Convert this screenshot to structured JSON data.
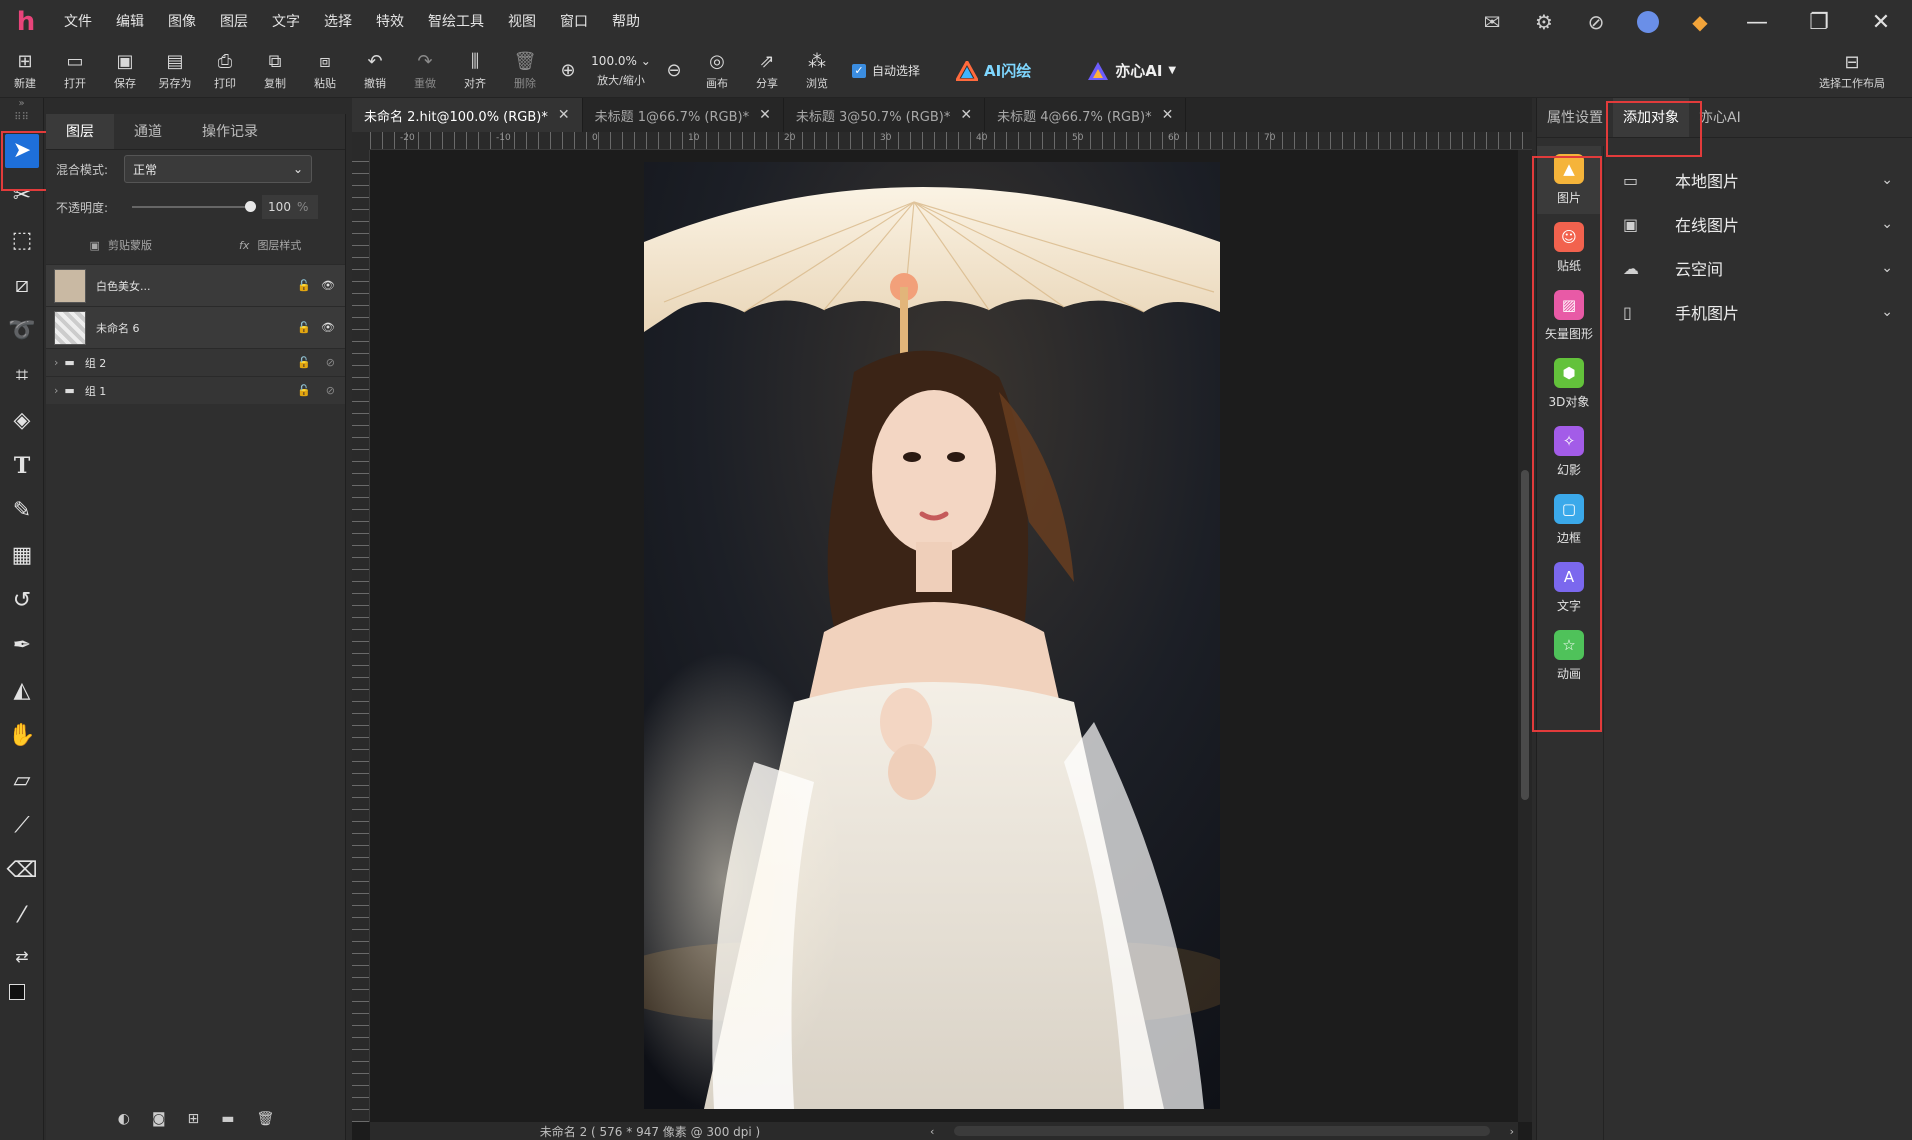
{
  "app": {
    "logo_text": "h",
    "menu": [
      "文件",
      "编辑",
      "图像",
      "图层",
      "文字",
      "选择",
      "特效",
      "智绘工具",
      "视图",
      "窗口",
      "帮助"
    ]
  },
  "toolbar": {
    "new": "新建",
    "open": "打开",
    "save": "保存",
    "save_as": "另存为",
    "print": "打印",
    "copy": "复制",
    "paste": "粘贴",
    "undo": "撤销",
    "redo": "重做",
    "align": "对齐",
    "delete": "删除",
    "zoom_value": "100.0%",
    "zoom_label": "放大/缩小",
    "canvas": "画布",
    "share": "分享",
    "browse": "浏览",
    "auto_select": "自动选择",
    "ai_flash": "AI闪绘",
    "yixin_ai": "亦心AI",
    "workspace": "选择工作布局"
  },
  "layers_panel": {
    "tabs": [
      "图层",
      "通道",
      "操作记录"
    ],
    "blend_label": "混合模式:",
    "blend_value": "正常",
    "opacity_label": "不透明度:",
    "opacity_value": "100",
    "opacity_unit": "%",
    "clip_label": "剪贴蒙版",
    "style_label": "图层样式",
    "layers": [
      {
        "name": "白色美女..."
      },
      {
        "name": "未命名 6"
      }
    ],
    "groups": [
      {
        "name": "组 2"
      },
      {
        "name": "组 1"
      }
    ]
  },
  "doc_tabs": [
    {
      "label": "未命名 2.hit@100.0% (RGB)*",
      "active": true
    },
    {
      "label": "未标题 1@66.7% (RGB)*",
      "active": false
    },
    {
      "label": "未标题 3@50.7% (RGB)*",
      "active": false
    },
    {
      "label": "未标题 4@66.7% (RGB)*",
      "active": false
    }
  ],
  "rulers": {
    "top": [
      "-20",
      "-10",
      "0",
      "10",
      "20",
      "30",
      "40",
      "50",
      "60",
      "70"
    ]
  },
  "status": {
    "text": "未命名 2 ( 576 * 947 像素 @ 300 dpi )"
  },
  "right_panel": {
    "tabs": [
      "属性设置",
      "添加对象",
      "亦心AI"
    ],
    "objects": [
      {
        "label": "图片",
        "icon": "image-icon",
        "color": "#f5b43a"
      },
      {
        "label": "贴纸",
        "icon": "sticker-icon",
        "color": "#f2624e"
      },
      {
        "label": "矢量图形",
        "icon": "vector-icon",
        "color": "#e85aa6"
      },
      {
        "label": "3D对象",
        "icon": "cube-icon",
        "color": "#63c23b"
      },
      {
        "label": "幻影",
        "icon": "phantom-icon",
        "color": "#a35ce8"
      },
      {
        "label": "边框",
        "icon": "frame-icon",
        "color": "#3ba9ea"
      },
      {
        "label": "文字",
        "icon": "text-icon",
        "color": "#7b68ee"
      },
      {
        "label": "动画",
        "icon": "star-icon",
        "color": "#4fc25a"
      }
    ],
    "sources": [
      {
        "label": "本地图片",
        "icon": "folder-icon"
      },
      {
        "label": "在线图片",
        "icon": "picture-icon"
      },
      {
        "label": "云空间",
        "icon": "cloud-icon"
      },
      {
        "label": "手机图片",
        "icon": "phone-icon"
      }
    ]
  },
  "colors": {
    "accent": "#1e6fd9",
    "highlight": "#e23b3b"
  }
}
